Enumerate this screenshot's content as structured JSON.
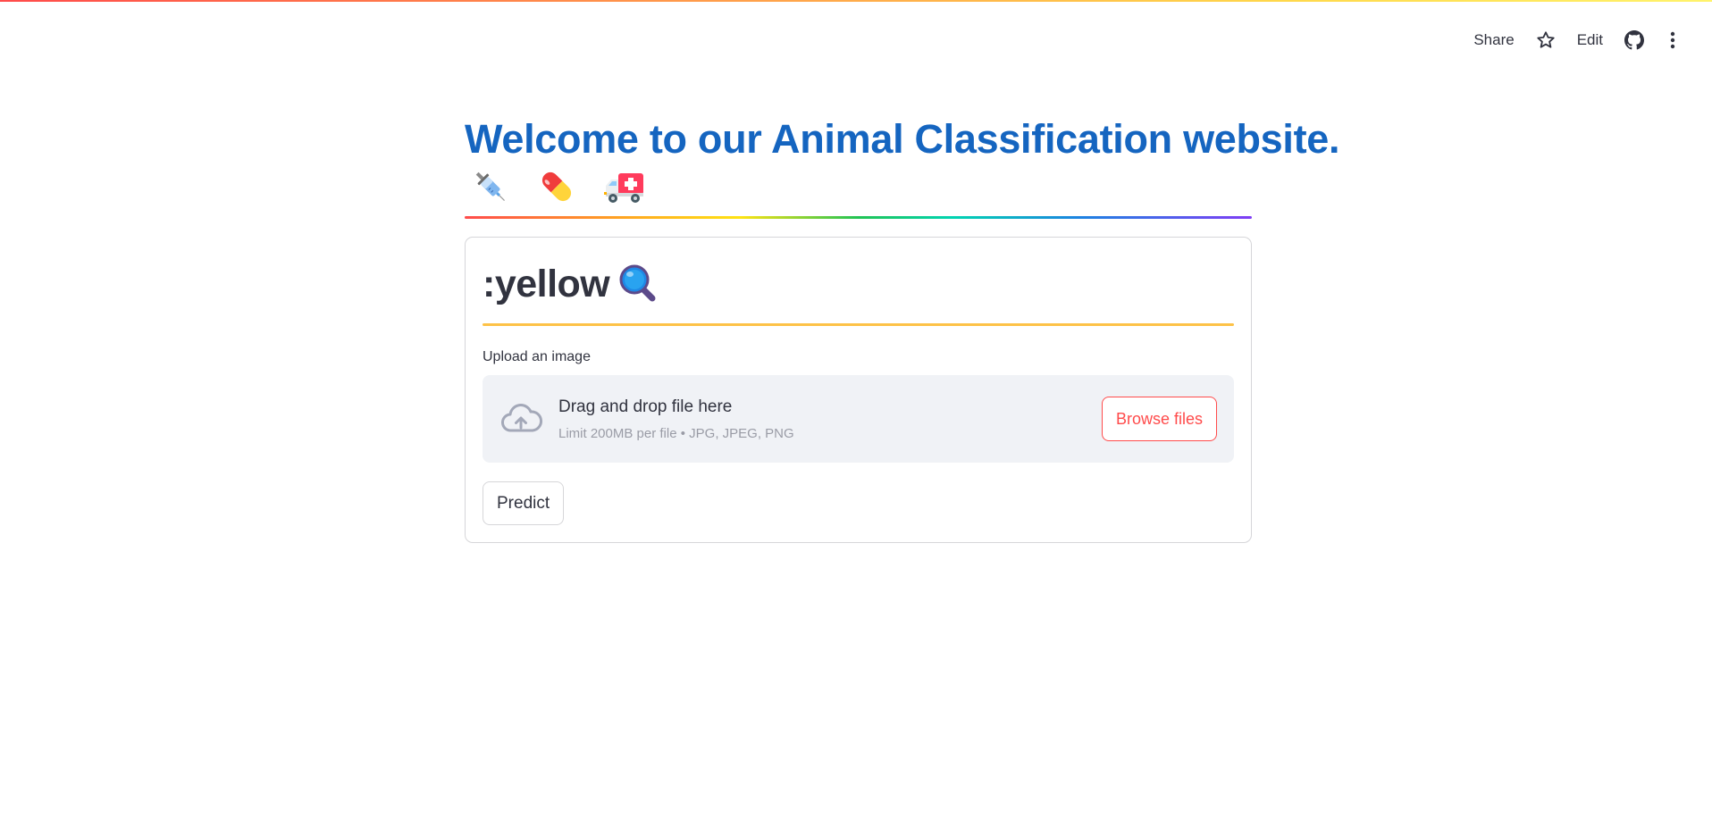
{
  "toolbar": {
    "share_label": "Share",
    "star_icon": "star-icon",
    "edit_label": "Edit",
    "github_icon": "github-icon",
    "menu_icon": "more-vertical-icon"
  },
  "header": {
    "title": "Welcome to our Animal Classification website.",
    "emojis": [
      "syringe-icon",
      "pill-icon",
      "ambulance-icon"
    ]
  },
  "card": {
    "subheader": ":yellow",
    "subheader_icon": "magnifying-glass-icon",
    "upload": {
      "label": "Upload an image",
      "drop_text": "Drag and drop file here",
      "limit_text": "Limit 200MB per file • JPG, JPEG, PNG",
      "browse_label": "Browse files",
      "icon": "cloud-upload-icon"
    },
    "predict_label": "Predict"
  },
  "colors": {
    "title": "#1565c0",
    "accent": "#ff4b4b",
    "yellow_divider": "#fdc247",
    "dropzone_bg": "#f0f2f6"
  }
}
